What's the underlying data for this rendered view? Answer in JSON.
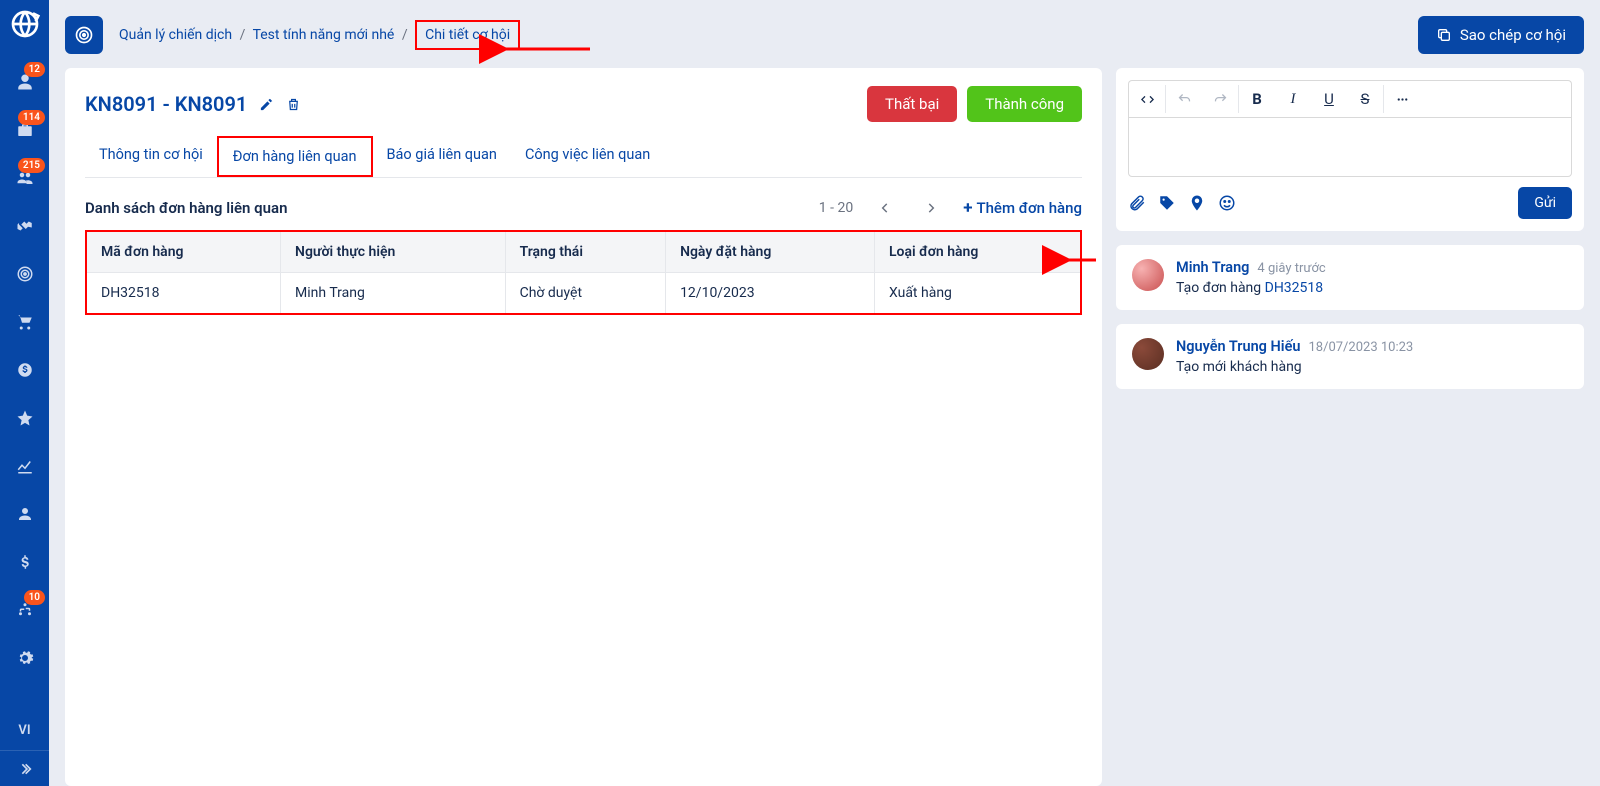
{
  "sidebar": {
    "badges": {
      "users": "12",
      "briefcase": "114",
      "group": "215",
      "org": "10"
    },
    "lang": "VI"
  },
  "breadcrumb": {
    "l0": "Quản lý chiến dịch",
    "l1": "Test tính năng mới nhé",
    "current": "Chi tiết cơ hội"
  },
  "buttons": {
    "copy": "Sao chép cơ hội",
    "fail": "Thất bại",
    "success": "Thành công",
    "send": "Gửi",
    "add_order": "Thêm đơn hàng"
  },
  "page_title": "KN8091 - KN8091",
  "tabs": {
    "info": "Thông tin cơ hội",
    "orders": "Đơn hàng liên quan",
    "quotes": "Báo giá liên quan",
    "tasks": "Công việc liên quan"
  },
  "orders": {
    "section_title": "Danh sách đơn hàng liên quan",
    "pager": "1 - 20",
    "headers": {
      "code": "Mã đơn hàng",
      "person": "Người thực hiện",
      "status": "Trạng thái",
      "date": "Ngày đặt hàng",
      "type": "Loại đơn hàng"
    },
    "rows": [
      {
        "code": "DH32518",
        "person": "Minh Trang",
        "status": "Chờ duyệt",
        "date": "12/10/2023",
        "type": "Xuất hàng"
      }
    ]
  },
  "activity": [
    {
      "name": "Minh Trang",
      "time": "4 giây trước",
      "text_prefix": "Tạo đơn hàng ",
      "link": "DH32518"
    },
    {
      "name": "Nguyễn Trung Hiếu",
      "time": "18/07/2023 10:23",
      "text": "Tạo mới khách hàng"
    }
  ]
}
